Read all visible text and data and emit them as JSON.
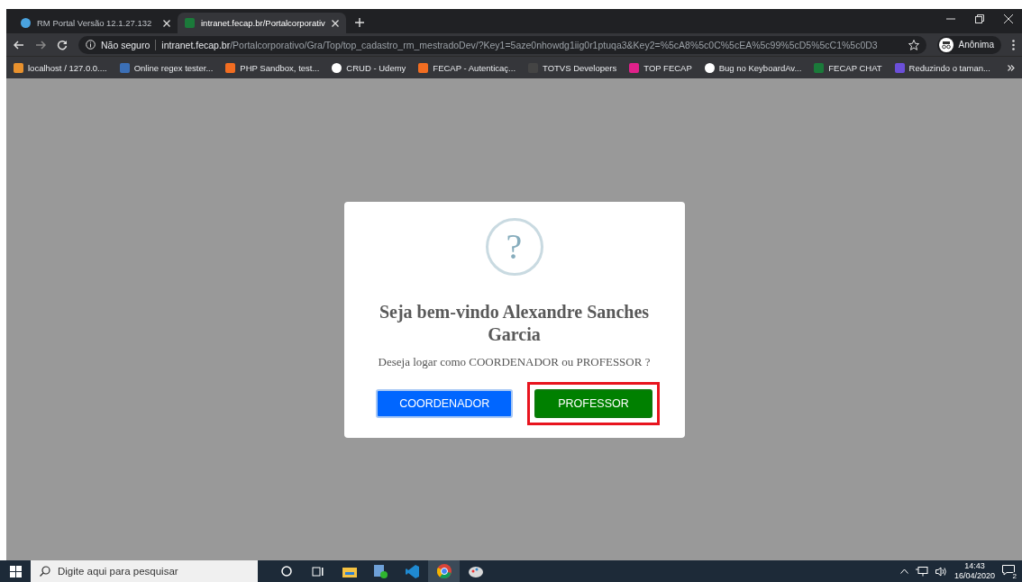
{
  "tabs": [
    {
      "title": "RM Portal Versão 12.1.27.132",
      "selected": false
    },
    {
      "title": "intranet.fecap.br/Portalcorporativ",
      "selected": true
    }
  ],
  "address": {
    "security": "Não seguro",
    "host": "intranet.fecap.br",
    "path": "/Portalcorporativo/Gra/Top/top_cadastro_rm_mestradoDev/?Key1=5aze0nhowdg1iig0r1ptuqa3&Key2=%5cA8%5c0C%5cEA%5c99%5cD5%5cC1%5c0D3"
  },
  "profile": "Anônima",
  "bookmarks": [
    {
      "label": "localhost / 127.0.0....",
      "color": "#e8912d"
    },
    {
      "label": "Online regex tester...",
      "color": "#3b6fb6"
    },
    {
      "label": "PHP Sandbox, test...",
      "color": "#f26d21"
    },
    {
      "label": "CRUD - Udemy",
      "color": "#ffffff"
    },
    {
      "label": "FECAP - Autenticaç...",
      "color": "#f26d21"
    },
    {
      "label": "TOTVS Developers",
      "color": "#444444"
    },
    {
      "label": "TOP FECAP",
      "color": "#e0218a"
    },
    {
      "label": "Bug no KeyboardAv...",
      "color": "#ffffff"
    },
    {
      "label": "FECAP CHAT",
      "color": "#1b7a3a"
    },
    {
      "label": "Reduzindo o taman...",
      "color": "#6b4fd8"
    }
  ],
  "dialog": {
    "icon": "?",
    "title": "Seja bem-vindo Alexandre Sanches Garcia",
    "message": "Deseja logar como COORDENADOR ou PROFESSOR ?",
    "buttons": [
      {
        "label": "COORDENADOR",
        "kind": "confirm",
        "highlighted": false
      },
      {
        "label": "PROFESSOR",
        "kind": "cancel",
        "highlighted": true
      }
    ]
  },
  "taskbar": {
    "search_placeholder": "Digite aqui para pesquisar",
    "apps": [
      {
        "kind": "cortana",
        "active": false
      },
      {
        "kind": "taskview",
        "active": false
      },
      {
        "kind": "explorer",
        "active": false
      },
      {
        "kind": "media",
        "active": false
      },
      {
        "kind": "vscode",
        "active": false
      },
      {
        "kind": "chrome",
        "active": true
      },
      {
        "kind": "paint",
        "active": false
      }
    ],
    "time": "14:43",
    "date": "16/04/2020",
    "notifications": "2"
  }
}
